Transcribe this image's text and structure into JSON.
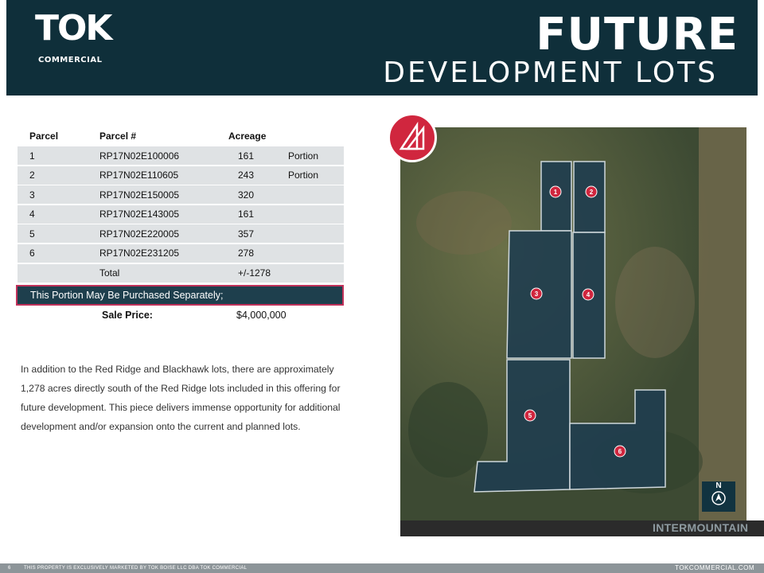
{
  "header": {
    "logo_main": "TOK",
    "logo_sub": "COMMERCIAL",
    "title": "FUTURE",
    "subtitle": "DEVELOPMENT LOTS"
  },
  "table": {
    "headers": [
      "Parcel",
      "Parcel #",
      "Acreage",
      ""
    ],
    "rows": [
      {
        "parcel": "1",
        "number": "RP17N02E100006",
        "acreage": "161",
        "note": "Portion"
      },
      {
        "parcel": "2",
        "number": "RP17N02E110605",
        "acreage": "243",
        "note": "Portion"
      },
      {
        "parcel": "3",
        "number": "RP17N02E150005",
        "acreage": "320",
        "note": ""
      },
      {
        "parcel": "4",
        "number": "RP17N02E143005",
        "acreage": "161",
        "note": ""
      },
      {
        "parcel": "5",
        "number": "RP17N02E220005",
        "acreage": "357",
        "note": ""
      },
      {
        "parcel": "6",
        "number": "RP17N02E231205",
        "acreage": "278",
        "note": ""
      }
    ],
    "total_label": "Total",
    "total_value": "+/-1278"
  },
  "purchase_note": "This Portion May Be Purchased Separately;",
  "sale_price_label": "Sale Price:",
  "sale_price_value": "$4,000,000",
  "description": "In addition to the Red Ridge and Blackhawk lots, there are approximately 1,278 acres directly south of the Red Ridge lots included in this offering for future development.  This piece delivers immense opportunity for additional development and/or expansion onto the current and planned lots.",
  "map": {
    "lot_labels": [
      "1",
      "2",
      "3",
      "4",
      "5",
      "6"
    ],
    "north_label": "N",
    "brand": "INTERMOUNTAIN",
    "overlay_color": "#1f3d4f",
    "marker_color": "#d0263e"
  },
  "footer": {
    "page": "6",
    "legal": "THIS PROPERTY IS EXCLUSIVELY MARKETED BY TOK BOISE LLC DBA TOK COMMERCIAL",
    "site": "TOKCOMMERCIAL.COM"
  }
}
